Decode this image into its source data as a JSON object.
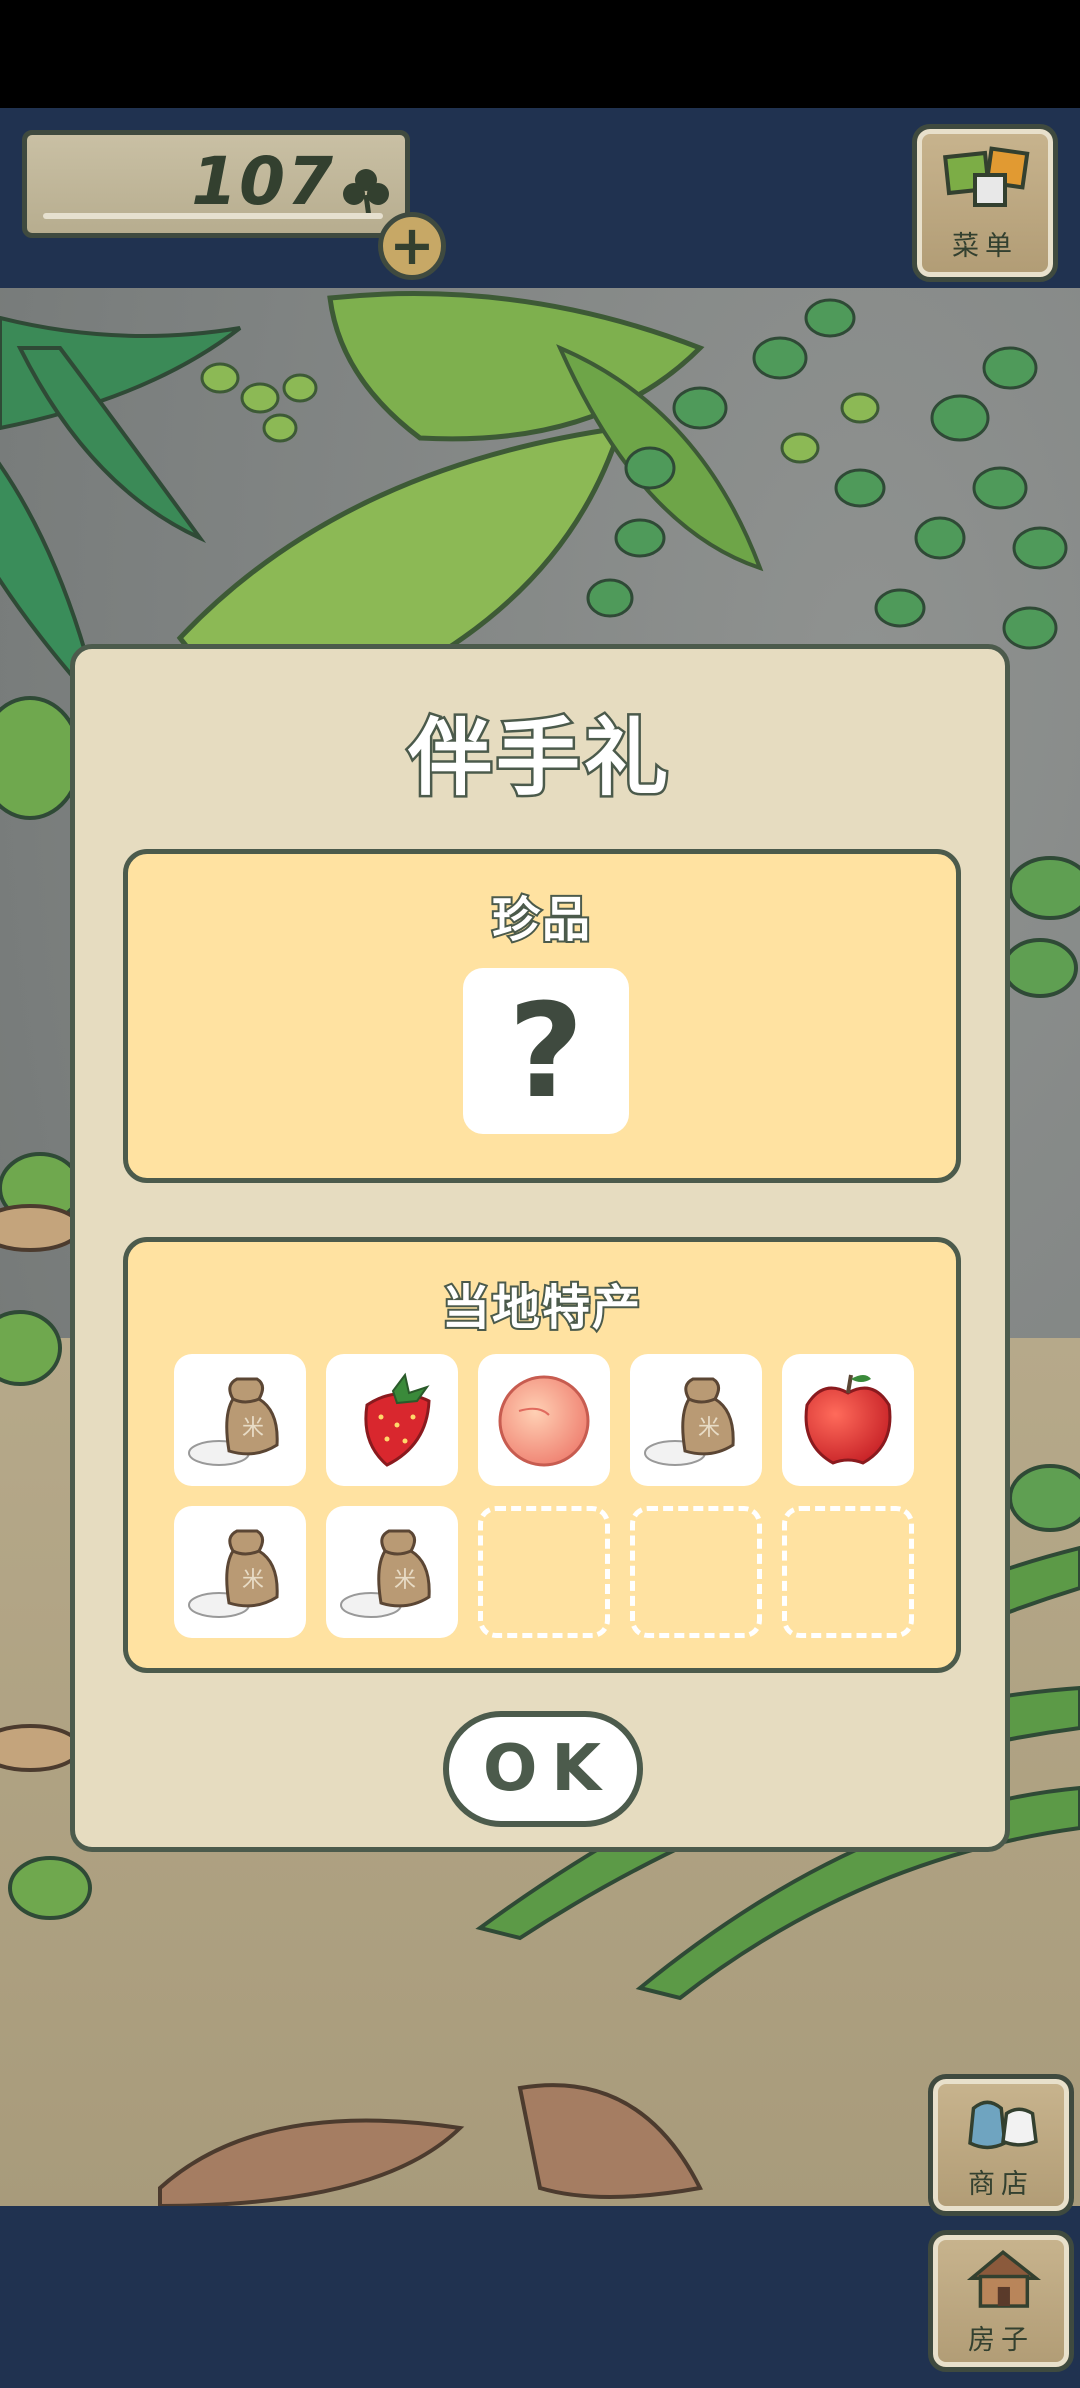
{
  "header": {
    "coin_value": "107",
    "coin_icon": "clover-icon",
    "add_icon": "plus-icon",
    "menu_label": "菜单"
  },
  "side": {
    "shop_label": "商店",
    "house_label": "房子"
  },
  "modal": {
    "title": "伴手礼",
    "rare": {
      "title": "珍品",
      "item": {
        "icon": "question-mark-icon",
        "text": "?"
      }
    },
    "local": {
      "title": "当地特产",
      "items": [
        {
          "icon": "rice-bag-icon",
          "text": "米"
        },
        {
          "icon": "strawberry-icon"
        },
        {
          "icon": "peach-icon"
        },
        {
          "icon": "rice-bag-icon",
          "text": "米"
        },
        {
          "icon": "apple-icon"
        },
        {
          "icon": "rice-bag-icon",
          "text": "米"
        },
        {
          "icon": "rice-bag-icon",
          "text": "米"
        },
        {
          "icon": "empty-slot"
        },
        {
          "icon": "empty-slot"
        },
        {
          "icon": "empty-slot"
        }
      ]
    },
    "ok_label": "OK"
  },
  "colors": {
    "band": "#203250",
    "modal_bg": "#e6dcc0",
    "panel_bg": "#ffe2a1",
    "outline": "#4c5b4c"
  }
}
